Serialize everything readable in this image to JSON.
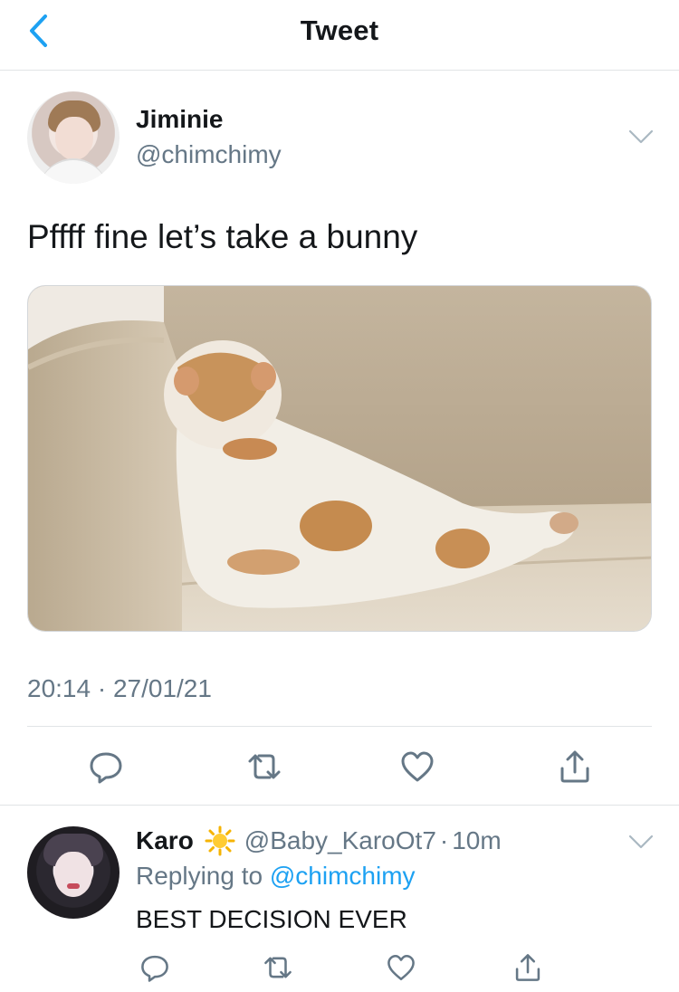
{
  "header": {
    "title": "Tweet",
    "back_icon": "chevron-left-icon",
    "accent_color": "#1da1f2"
  },
  "tweet": {
    "author_name": "Jiminie",
    "author_handle": "@chimchimy",
    "text": "Pffff fine let’s take a bunny",
    "media_description": "cat-on-sofa-photo",
    "time": "20:14 · 27/01/21",
    "actions": [
      {
        "icon": "reply-icon"
      },
      {
        "icon": "retweet-icon"
      },
      {
        "icon": "like-icon"
      },
      {
        "icon": "share-icon"
      }
    ]
  },
  "reply": {
    "author_name": "Karo",
    "emoji": "sun-emoji",
    "author_handle": "@Baby_KaroOt7",
    "separator": "·",
    "time": "10m",
    "replying_prefix": "Replying to",
    "replying_to": "@chimchimy",
    "text": "BEST DECISION EVER",
    "actions": [
      {
        "icon": "reply-icon"
      },
      {
        "icon": "retweet-icon"
      },
      {
        "icon": "like-icon"
      },
      {
        "icon": "share-icon"
      }
    ]
  },
  "colors": {
    "text_primary": "#14171a",
    "text_secondary": "#657786",
    "link": "#1da1f2",
    "divider": "#e1e4e6"
  }
}
